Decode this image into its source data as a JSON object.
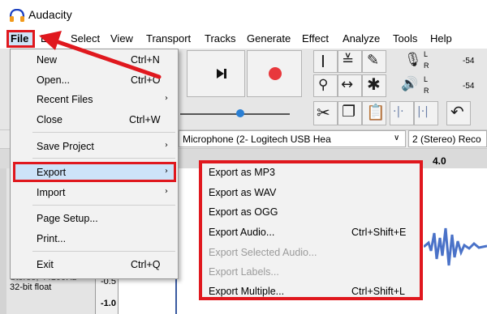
{
  "app": {
    "title": "Audacity"
  },
  "menubar": {
    "items": [
      "File",
      "Edit",
      "Select",
      "View",
      "Transport",
      "Tracks",
      "Generate",
      "Effect",
      "Analyze",
      "Tools",
      "Help"
    ]
  },
  "file_menu": {
    "items": [
      {
        "label": "New",
        "shortcut": "Ctrl+N"
      },
      {
        "label": "Open...",
        "shortcut": "Ctrl+O"
      },
      {
        "label": "Recent Files",
        "shortcut": ""
      },
      {
        "label": "Close",
        "shortcut": "Ctrl+W"
      },
      {
        "label": "Save Project",
        "shortcut": ""
      },
      {
        "label": "Export",
        "shortcut": ""
      },
      {
        "label": "Import",
        "shortcut": ""
      },
      {
        "label": "Page Setup...",
        "shortcut": ""
      },
      {
        "label": "Print...",
        "shortcut": ""
      },
      {
        "label": "Exit",
        "shortcut": "Ctrl+Q"
      }
    ],
    "submenu_arrow": "›"
  },
  "export_menu": {
    "items": [
      {
        "label": "Export as MP3",
        "shortcut": "",
        "enabled": true
      },
      {
        "label": "Export as WAV",
        "shortcut": "",
        "enabled": true
      },
      {
        "label": "Export as OGG",
        "shortcut": "",
        "enabled": true
      },
      {
        "label": "Export Audio...",
        "shortcut": "Ctrl+Shift+E",
        "enabled": true
      },
      {
        "label": "Export Selected Audio...",
        "shortcut": "",
        "enabled": false
      },
      {
        "label": "Export Labels...",
        "shortcut": "",
        "enabled": false
      },
      {
        "label": "Export Multiple...",
        "shortcut": "Ctrl+Shift+L",
        "enabled": true
      }
    ]
  },
  "toolbar": {
    "meter_labels": [
      "L",
      "R",
      "L",
      "R"
    ],
    "meter_values": [
      "-54",
      "-54"
    ],
    "icons": [
      "skip-end-icon",
      "record-icon",
      "select-tool-icon",
      "envelope-tool-icon",
      "draw-tool-icon",
      "microphone-icon",
      "zoom-tool-icon",
      "time-shift-icon",
      "multi-tool-icon",
      "speaker-icon",
      "cut-icon",
      "copy-icon",
      "paste-icon",
      "trim-icon",
      "silence-icon",
      "undo-icon"
    ]
  },
  "device_bar": {
    "microphone": "Microphone (2- Logitech USB Hea",
    "channels": "2 (Stereo) Reco"
  },
  "timeline": {
    "label": "4.0"
  },
  "track": {
    "info_line": "Stereo, 44100Hz",
    "format": "32-bit float",
    "scale_values": [
      "-0.5",
      "-1.0"
    ]
  },
  "colors": {
    "highlight_red": "#e0181e",
    "record_red": "#e8383c",
    "menu_hover": "#cde3f8",
    "waveform": "#4a72c8",
    "slider_blue": "#2a7fd4"
  }
}
